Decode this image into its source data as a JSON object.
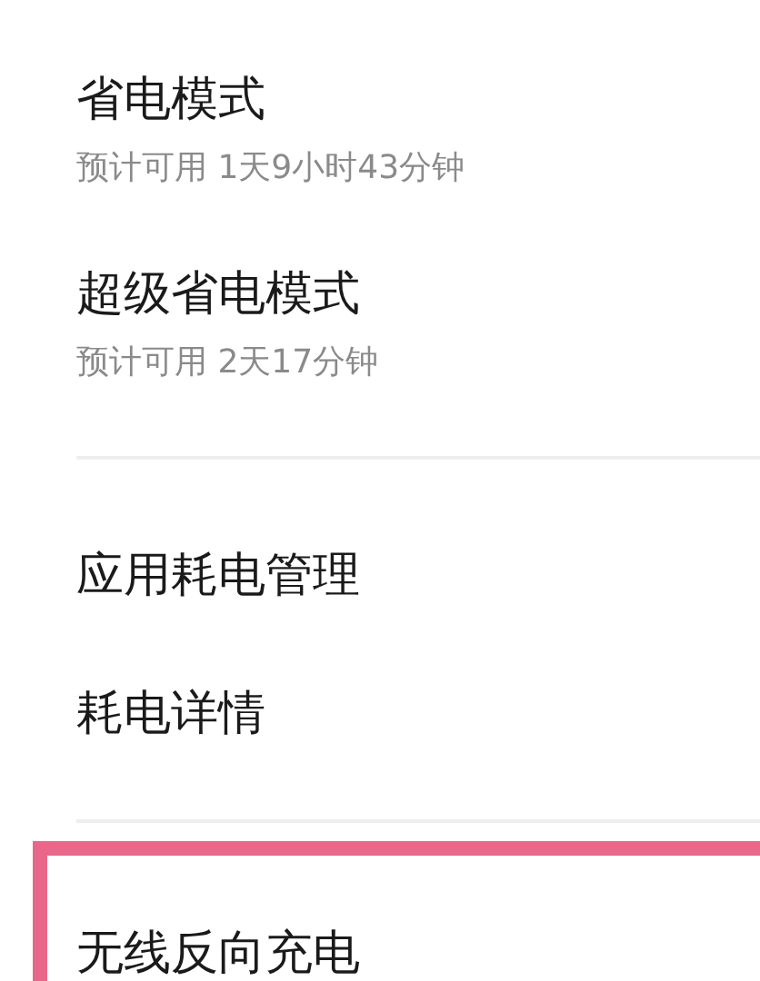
{
  "sections": [
    {
      "items": [
        {
          "title": "省电模式",
          "subtitle": "预计可用 1天9小时43分钟",
          "highlighted": false
        },
        {
          "title": "超级省电模式",
          "subtitle": "预计可用 2天17分钟",
          "highlighted": false
        }
      ]
    },
    {
      "items": [
        {
          "title": "应用耗电管理",
          "highlighted": false
        },
        {
          "title": "耗电详情",
          "highlighted": false
        }
      ]
    },
    {
      "items": [
        {
          "title": "无线反向充电",
          "highlighted": true
        }
      ]
    }
  ]
}
